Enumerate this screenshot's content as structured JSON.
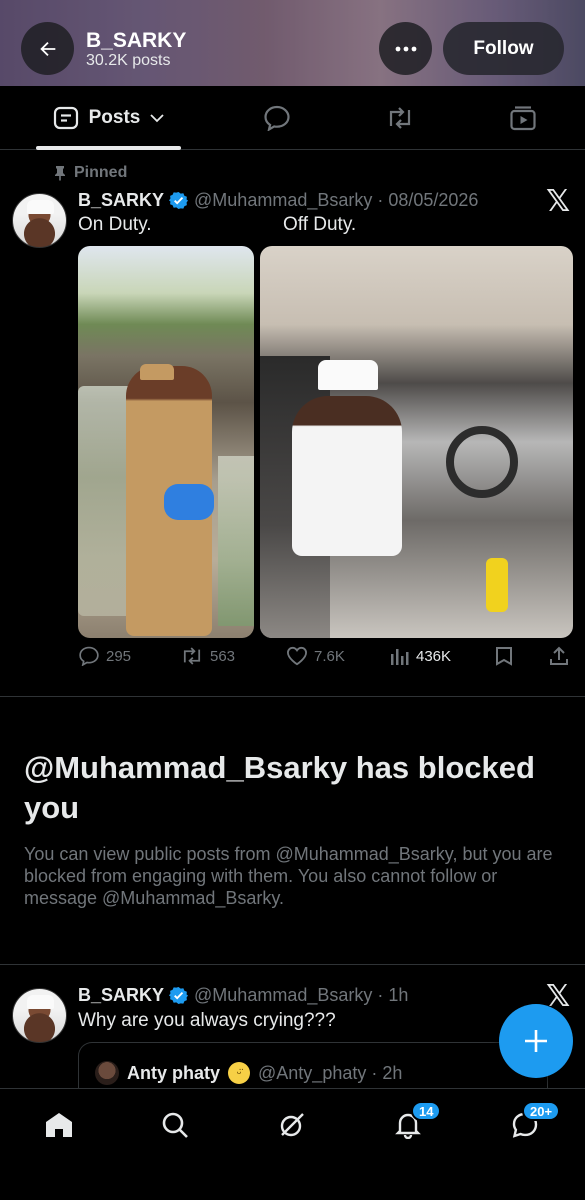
{
  "header": {
    "name": "B_SARKY",
    "post_count": "30.2K posts",
    "follow_label": "Follow"
  },
  "tabs": [
    {
      "label": "Posts",
      "icon": "posts-icon"
    },
    {
      "label": "",
      "icon": "replies-icon"
    },
    {
      "label": "",
      "icon": "reposts-icon"
    },
    {
      "label": "",
      "icon": "media-icon"
    }
  ],
  "pinned_post": {
    "pinned_label": "Pinned",
    "name": "B_SARKY",
    "handle_date": "@Muhammad_Bsarky · 08/05/2026",
    "text_left": "On Duty.",
    "text_right": "Off Duty.",
    "stats": {
      "replies": "295",
      "reposts": "563",
      "likes": "7.6K",
      "views": "436K"
    }
  },
  "blocked": {
    "title": "@Muhammad_Bsarky has blocked you",
    "body": "You can view public posts from @Muhammad_Bsarky, but you are blocked from engaging with them. You also cannot follow or message @Muhammad_Bsarky."
  },
  "second_post": {
    "name": "B_SARKY",
    "handle_time": "@Muhammad_Bsarky · 1h",
    "text": "Why are you always crying???",
    "quote": {
      "name": "Anty phaty",
      "handle_time": "@Anty_phaty · 2h"
    }
  },
  "bottom_nav": {
    "notifications_badge": "14",
    "messages_badge": "20+"
  },
  "colors": {
    "accent": "#1d9bf0",
    "text": "#e7e9ea",
    "muted": "#71767b",
    "border": "#2f3336"
  }
}
